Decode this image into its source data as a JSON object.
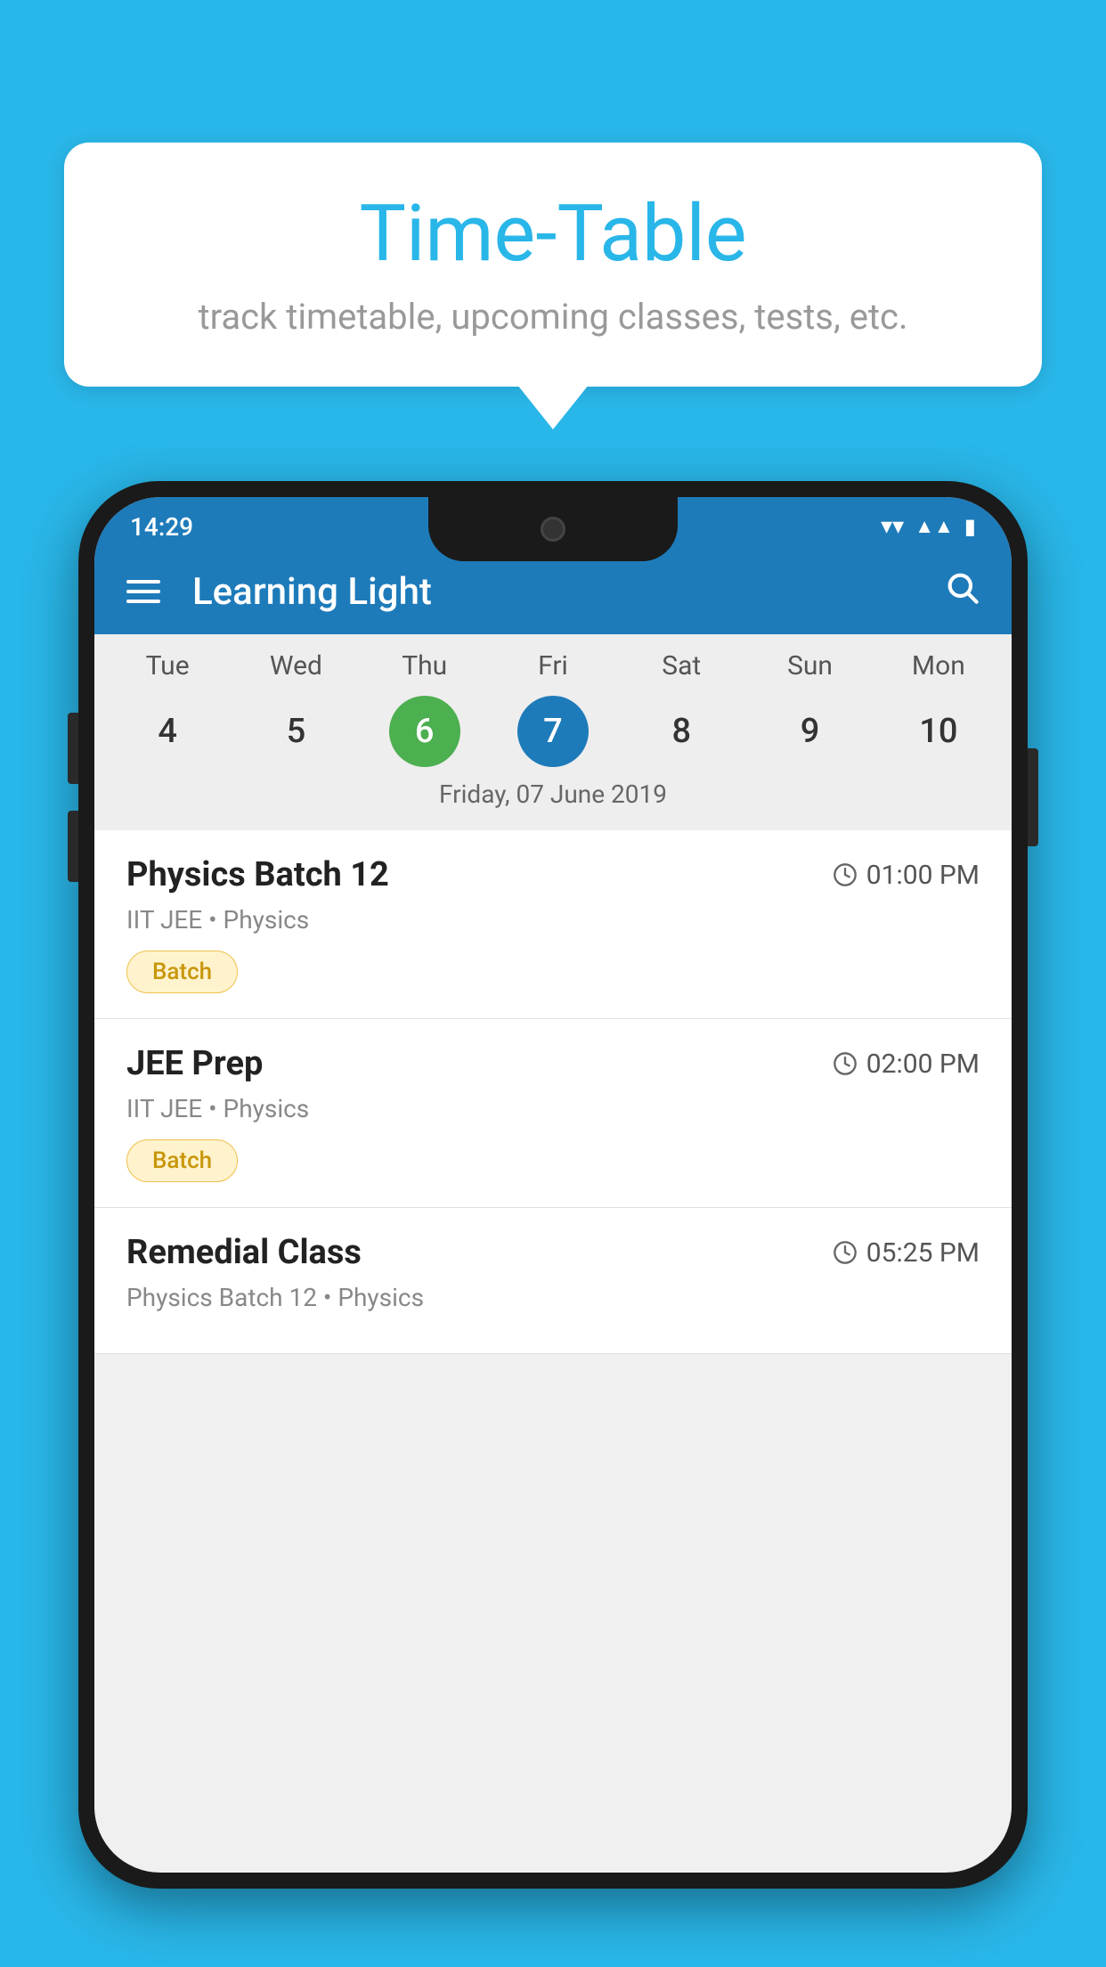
{
  "background": {
    "color": "#29b6e8"
  },
  "speech_bubble": {
    "title": "Time-Table",
    "subtitle": "track timetable, upcoming classes, tests, etc."
  },
  "phone": {
    "status_bar": {
      "time": "14:29"
    },
    "app_bar": {
      "title": "Learning Light"
    },
    "calendar": {
      "day_headers": [
        "Tue",
        "Wed",
        "Thu",
        "Fri",
        "Sat",
        "Sun",
        "Mon"
      ],
      "day_numbers": [
        "4",
        "5",
        "6",
        "7",
        "8",
        "9",
        "10"
      ],
      "today_index": 2,
      "selected_index": 3,
      "selected_date_label": "Friday, 07 June 2019"
    },
    "classes": [
      {
        "name": "Physics Batch 12",
        "time": "01:00 PM",
        "meta": "IIT JEE • Physics",
        "tag": "Batch"
      },
      {
        "name": "JEE Prep",
        "time": "02:00 PM",
        "meta": "IIT JEE • Physics",
        "tag": "Batch"
      },
      {
        "name": "Remedial Class",
        "time": "05:25 PM",
        "meta": "Physics Batch 12 • Physics",
        "tag": ""
      }
    ]
  }
}
